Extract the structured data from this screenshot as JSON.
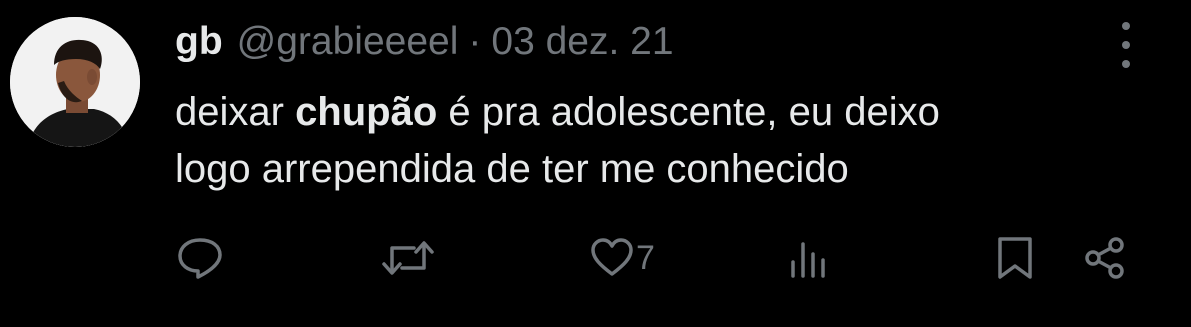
{
  "tweet": {
    "display_name": "gb",
    "handle": "@grabieeeel",
    "separator": "·",
    "date": "03 dez. 21",
    "text_before": "deixar ",
    "text_bold": "chupão",
    "text_line1_after": " é pra adolescente, eu deixo",
    "text_line2": "logo arrependida de ter me conhecido"
  },
  "actions": {
    "reply": {
      "icon": "reply-icon"
    },
    "retweet": {
      "icon": "retweet-icon"
    },
    "like": {
      "icon": "heart-icon",
      "count": "7"
    },
    "views": {
      "icon": "views-icon"
    },
    "bookmark": {
      "icon": "bookmark-icon"
    },
    "share": {
      "icon": "share-icon"
    }
  },
  "colors": {
    "background": "#000000",
    "primary_text": "#e7e9ea",
    "secondary_text": "#71767b"
  }
}
